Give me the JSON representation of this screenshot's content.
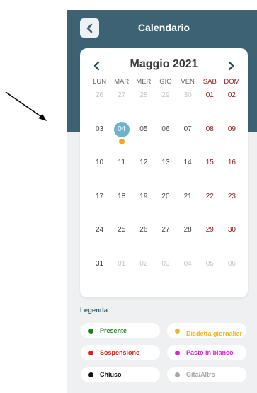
{
  "header": {
    "title": "Calendario",
    "back_icon": "chevron-left-icon"
  },
  "calendar": {
    "month_label": "Maggio 2021",
    "prev_icon": "chevron-left-icon",
    "next_icon": "chevron-right-icon",
    "weekdays": [
      {
        "label": "LUN",
        "weekend": false
      },
      {
        "label": "MAR",
        "weekend": false
      },
      {
        "label": "MER",
        "weekend": false
      },
      {
        "label": "GIO",
        "weekend": false
      },
      {
        "label": "VEN",
        "weekend": false
      },
      {
        "label": "SAB",
        "weekend": true
      },
      {
        "label": "DOM",
        "weekend": true
      }
    ],
    "days": [
      {
        "label": "26",
        "state": "out"
      },
      {
        "label": "27",
        "state": "out"
      },
      {
        "label": "28",
        "state": "out"
      },
      {
        "label": "29",
        "state": "out"
      },
      {
        "label": "30",
        "state": "out"
      },
      {
        "label": "01",
        "state": "weekend"
      },
      {
        "label": "02",
        "state": "weekend"
      },
      {
        "label": "03",
        "state": "normal"
      },
      {
        "label": "04",
        "state": "today",
        "marker": "#f5a623"
      },
      {
        "label": "05",
        "state": "normal"
      },
      {
        "label": "06",
        "state": "normal"
      },
      {
        "label": "07",
        "state": "normal"
      },
      {
        "label": "08",
        "state": "weekend"
      },
      {
        "label": "09",
        "state": "weekend"
      },
      {
        "label": "10",
        "state": "normal"
      },
      {
        "label": "11",
        "state": "normal"
      },
      {
        "label": "12",
        "state": "normal"
      },
      {
        "label": "13",
        "state": "normal"
      },
      {
        "label": "14",
        "state": "normal"
      },
      {
        "label": "15",
        "state": "weekend"
      },
      {
        "label": "16",
        "state": "weekend"
      },
      {
        "label": "17",
        "state": "normal"
      },
      {
        "label": "18",
        "state": "normal"
      },
      {
        "label": "19",
        "state": "normal"
      },
      {
        "label": "20",
        "state": "normal"
      },
      {
        "label": "21",
        "state": "normal"
      },
      {
        "label": "22",
        "state": "weekend"
      },
      {
        "label": "23",
        "state": "weekend"
      },
      {
        "label": "24",
        "state": "normal"
      },
      {
        "label": "25",
        "state": "normal"
      },
      {
        "label": "26",
        "state": "normal"
      },
      {
        "label": "27",
        "state": "normal"
      },
      {
        "label": "28",
        "state": "normal"
      },
      {
        "label": "29",
        "state": "weekend"
      },
      {
        "label": "30",
        "state": "weekend"
      },
      {
        "label": "31",
        "state": "normal"
      },
      {
        "label": "01",
        "state": "out"
      },
      {
        "label": "02",
        "state": "out"
      },
      {
        "label": "03",
        "state": "out"
      },
      {
        "label": "04",
        "state": "out"
      },
      {
        "label": "05",
        "state": "out"
      },
      {
        "label": "06",
        "state": "out"
      }
    ]
  },
  "legend": {
    "title": "Legenda",
    "items": [
      {
        "label": "Presente",
        "color": "#1a7f1a",
        "text_color": "#1a7f1a"
      },
      {
        "label": "Disdetta giornalier",
        "color": "#f0b429",
        "text_color": "#f0b429"
      },
      {
        "label": "Sospensione",
        "color": "#e32020",
        "text_color": "#e32020"
      },
      {
        "label": "Pasto in bianco",
        "color": "#e020d8",
        "text_color": "#e020d8"
      },
      {
        "label": "Chiuso",
        "color": "#111111",
        "text_color": "#111111"
      },
      {
        "label": "Gita/Altro",
        "color": "#a6a6a6",
        "text_color": "#a6a6a6"
      }
    ]
  },
  "colors": {
    "header_band": "#3d6273",
    "today_highlight": "#6fb2cd",
    "weekend_text": "#8b1a1a",
    "annotation_arrow": "#000000"
  }
}
